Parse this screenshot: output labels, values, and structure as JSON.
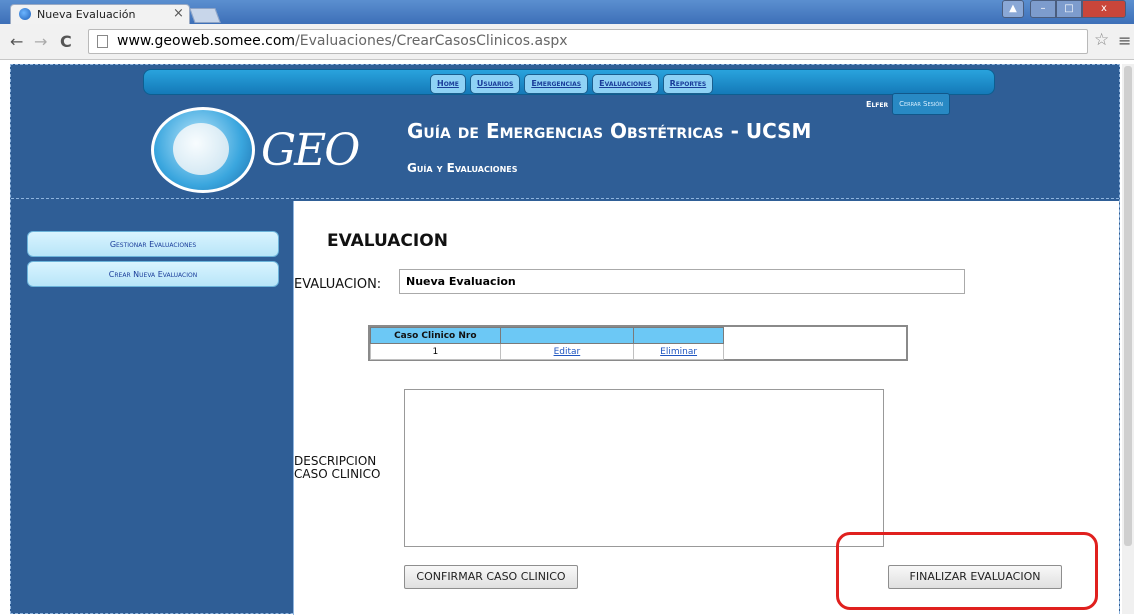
{
  "browser": {
    "tab_title": "Nueva Evaluación",
    "tab_close": "×",
    "url_host": "www.geoweb.somee.com",
    "url_path": "/Evaluaciones/CrearCasosClinicos.aspx"
  },
  "nav": {
    "items": [
      "Home",
      "Usuarios",
      "Emergencias",
      "Evaluaciones",
      "Reportes"
    ]
  },
  "user": {
    "name": "Elfer",
    "logout": "Cerrar Sesión"
  },
  "header": {
    "logo_text": "GEO",
    "title": "Guía de Emergencias Obstétricas - UCSM",
    "subtitle": "Guía y Evaluaciones"
  },
  "sidebar": {
    "items": [
      "Gestionar Evaluaciones",
      "Crear Nueva Evaluacion"
    ]
  },
  "main": {
    "heading": "EVALUACION",
    "evaluation_label": "EVALUACION:",
    "evaluation_value": "Nueva Evaluacion",
    "table": {
      "headers": [
        "Caso Clinico Nro",
        "",
        ""
      ],
      "rows": [
        [
          "1",
          "Editar",
          "Eliminar"
        ]
      ]
    },
    "description_label_1": "DESCRIPCION",
    "description_label_2": "CASO CLINICO",
    "confirm_button": "CONFIRMAR CASO CLINICO",
    "finish_button": "FINALIZAR EVALUACION"
  },
  "colors": {
    "page_bg": "#2f5e96",
    "nav_bar": "#1479b8",
    "highlight": "#e0201e"
  }
}
